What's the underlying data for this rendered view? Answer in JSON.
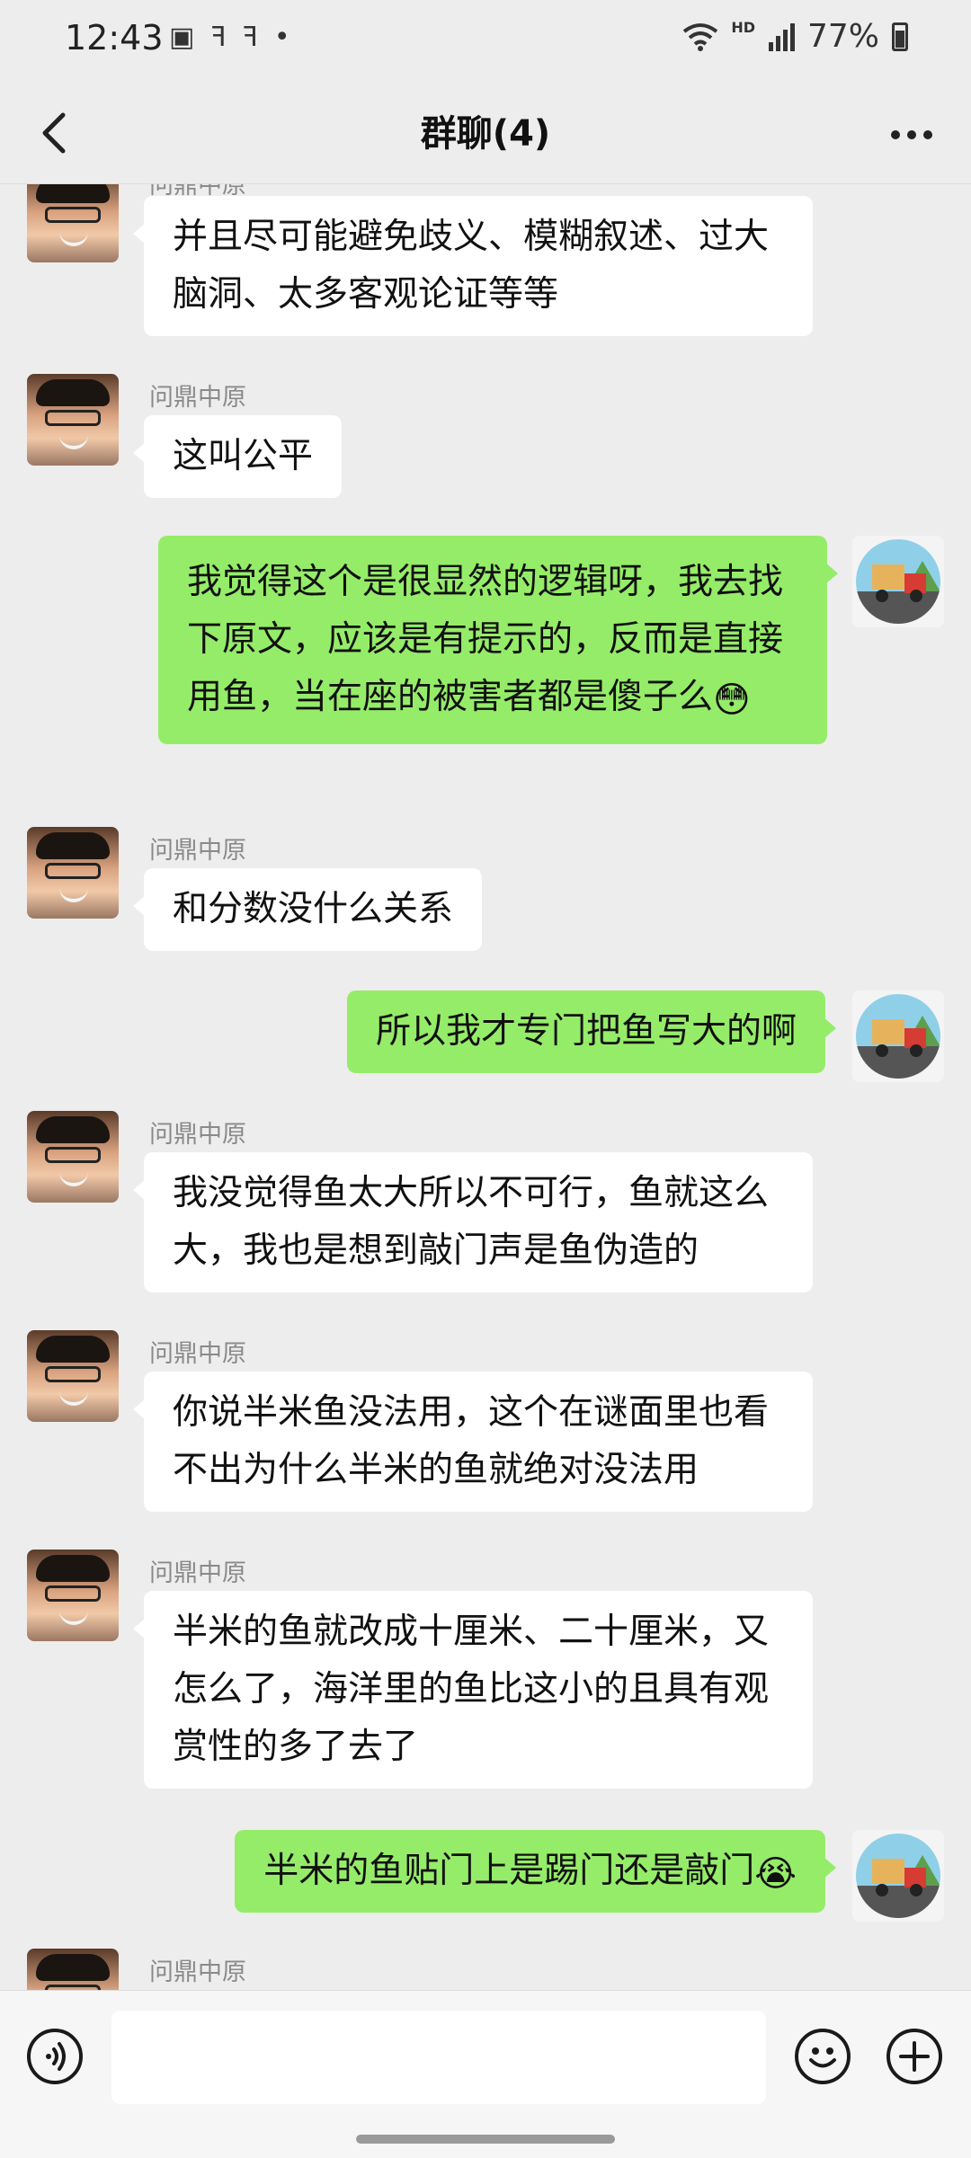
{
  "status_bar": {
    "time": "12:43",
    "hd_label": "HD",
    "battery_percent": "77%"
  },
  "header": {
    "title": "群聊(4)"
  },
  "messages": [
    {
      "side": "in",
      "sender": "问鼎中原",
      "text": "并且尽可能避免歧义、模糊叙述、过大脑洞、太多客观论证等等"
    },
    {
      "side": "in",
      "sender": "问鼎中原",
      "text": "这叫公平"
    },
    {
      "side": "out",
      "text": "我觉得这个是很显然的逻辑呀，我去找下原文，应该是有提示的，反而是直接用鱼，当在座的被害者都是傻子么",
      "emoji": "😳"
    },
    {
      "side": "in",
      "sender": "问鼎中原",
      "text": "和分数没什么关系"
    },
    {
      "side": "out",
      "text": "所以我才专门把鱼写大的啊"
    },
    {
      "side": "in",
      "sender": "问鼎中原",
      "text": "我没觉得鱼太大所以不可行，鱼就这么大，我也是想到敲门声是鱼伪造的"
    },
    {
      "side": "in",
      "sender": "问鼎中原",
      "text": "你说半米鱼没法用，这个在谜面里也看不出为什么半米的鱼就绝对没法用"
    },
    {
      "side": "in",
      "sender": "问鼎中原",
      "text": "半米的鱼就改成十厘米、二十厘米，又怎么了，海洋里的鱼比这小的且具有观赏性的多了去了"
    },
    {
      "side": "out",
      "text": "半米的鱼贴门上是踢门还是敲门",
      "emoji": "😭"
    },
    {
      "side": "in",
      "sender": "问鼎中原",
      "text": ""
    }
  ],
  "colors": {
    "background": "#ededed",
    "bubble_out": "#95ec69",
    "bubble_in": "#ffffff"
  }
}
